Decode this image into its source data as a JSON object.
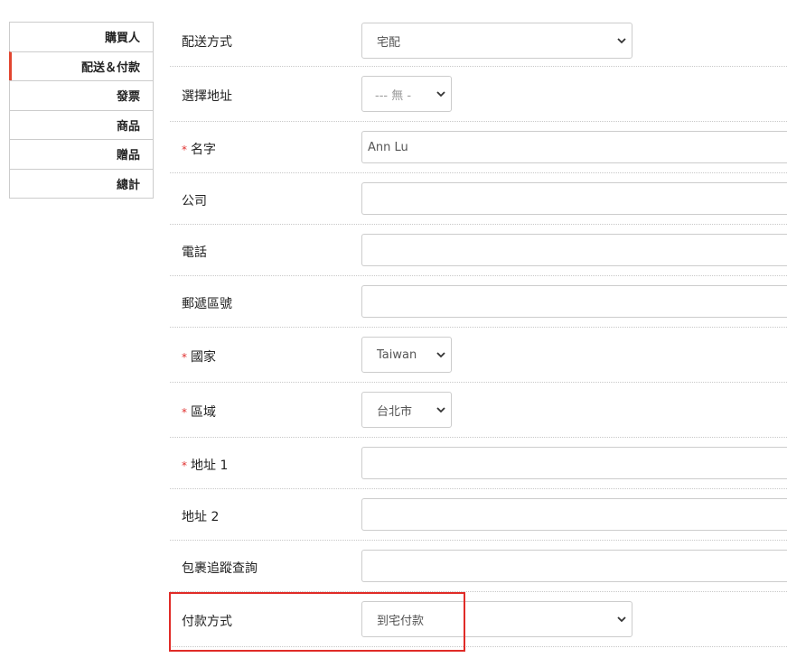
{
  "sidebar": {
    "items": [
      {
        "label": "購買人"
      },
      {
        "label": "配送＆付款"
      },
      {
        "label": "發票"
      },
      {
        "label": "商品"
      },
      {
        "label": "贈品"
      },
      {
        "label": "總計"
      }
    ]
  },
  "form": {
    "shipping_method": {
      "label": "配送方式",
      "value": "宅配"
    },
    "address_select": {
      "label": "選擇地址",
      "value": "--- 無 -"
    },
    "name": {
      "label": "名字",
      "value": "Ann Lu"
    },
    "company": {
      "label": "公司",
      "value": ""
    },
    "phone": {
      "label": "電話",
      "value": ""
    },
    "postcode": {
      "label": "郵遞區號",
      "value": ""
    },
    "country": {
      "label": "國家",
      "value": "Taiwan"
    },
    "region": {
      "label": "區域",
      "value": "台北市"
    },
    "address1": {
      "label": "地址 1",
      "value": ""
    },
    "address2": {
      "label": "地址 2",
      "value": ""
    },
    "tracking": {
      "label": "包裹追蹤查詢",
      "value": ""
    },
    "payment_method": {
      "label": "付款方式",
      "value": "到宅付款"
    }
  },
  "required_marker": "*",
  "colors": {
    "accent": "#e2452f",
    "required": "#e0312f",
    "highlight": "#e02b27",
    "border": "#cccccc"
  }
}
